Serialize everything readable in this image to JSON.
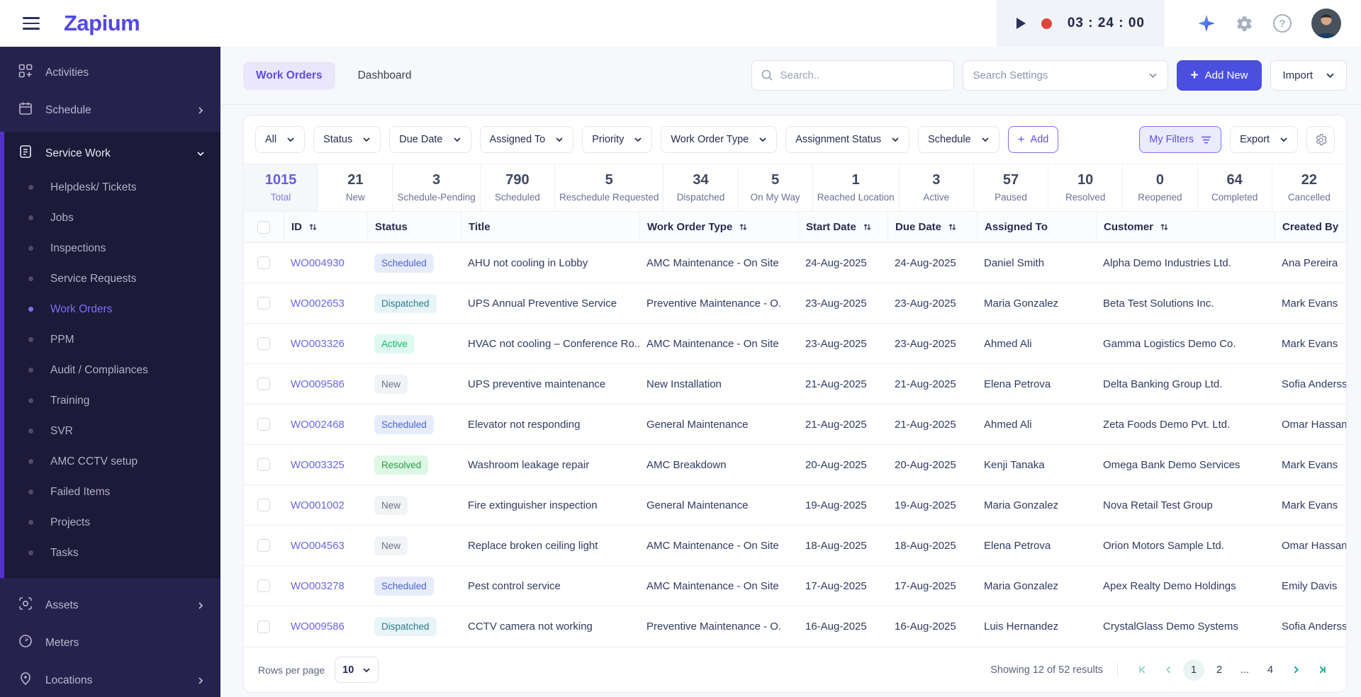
{
  "brand": {
    "name": "Zapium",
    "color": "#5248e5"
  },
  "header": {
    "timer": {
      "time": "03 : 24 : 00"
    }
  },
  "sidebar": {
    "top_items": [
      {
        "label": "Activities"
      },
      {
        "label": "Schedule"
      }
    ],
    "section": {
      "label": "Service Work"
    },
    "sub_items": [
      {
        "label": "Helpdesk/ Tickets",
        "cls": ""
      },
      {
        "label": "Jobs",
        "cls": ""
      },
      {
        "label": "Inspections",
        "cls": ""
      },
      {
        "label": "Service Requests",
        "cls": ""
      },
      {
        "label": "Work Orders",
        "cls": "active"
      },
      {
        "label": "PPM",
        "cls": ""
      },
      {
        "label": "Audit / Compliances",
        "cls": ""
      },
      {
        "label": "Training",
        "cls": ""
      },
      {
        "label": "SVR",
        "cls": ""
      },
      {
        "label": "AMC CCTV setup",
        "cls": ""
      },
      {
        "label": "Failed Items",
        "cls": ""
      },
      {
        "label": "Projects",
        "cls": ""
      },
      {
        "label": "Tasks",
        "cls": ""
      }
    ],
    "bottom_items": [
      {
        "label": "Assets"
      },
      {
        "label": "Meters"
      },
      {
        "label": "Locations"
      }
    ]
  },
  "toolbar": {
    "tabs": [
      {
        "label": "Work Orders"
      },
      {
        "label": "Dashboard"
      }
    ],
    "search_placeholder": "Search..",
    "search_settings_value": "Search Settings",
    "add_new_label": "Add New",
    "import_label": "Import"
  },
  "filters": {
    "dropdowns": [
      {
        "label": "All"
      },
      {
        "label": "Status"
      },
      {
        "label": "Due Date"
      },
      {
        "label": "Assigned To"
      },
      {
        "label": "Priority"
      },
      {
        "label": "Work Order Type"
      },
      {
        "label": "Assignment Status"
      },
      {
        "label": "Schedule"
      }
    ],
    "add_label": "Add",
    "my_filters_label": "My Filters",
    "export_label": "Export"
  },
  "stats": [
    {
      "value": "1015",
      "label": "Total",
      "cls": "total"
    },
    {
      "value": "21",
      "label": "New",
      "cls": ""
    },
    {
      "value": "3",
      "label": "Schedule-Pending",
      "cls": ""
    },
    {
      "value": "790",
      "label": "Scheduled",
      "cls": ""
    },
    {
      "value": "5",
      "label": "Reschedule Requested",
      "cls": ""
    },
    {
      "value": "34",
      "label": "Dispatched",
      "cls": ""
    },
    {
      "value": "5",
      "label": "On My Way",
      "cls": ""
    },
    {
      "value": "1",
      "label": "Reached Location",
      "cls": ""
    },
    {
      "value": "3",
      "label": "Active",
      "cls": ""
    },
    {
      "value": "57",
      "label": "Paused",
      "cls": ""
    },
    {
      "value": "10",
      "label": "Resolved",
      "cls": ""
    },
    {
      "value": "0",
      "label": "Reopened",
      "cls": ""
    },
    {
      "value": "64",
      "label": "Completed",
      "cls": ""
    },
    {
      "value": "22",
      "label": "Cancelled",
      "cls": ""
    }
  ],
  "table": {
    "columns": [
      {
        "label": "ID",
        "sort": "sortable"
      },
      {
        "label": "Status",
        "sort": ""
      },
      {
        "label": "Title",
        "sort": ""
      },
      {
        "label": "Work Order Type",
        "sort": "sortable"
      },
      {
        "label": "Start Date",
        "sort": "sortable"
      },
      {
        "label": "Due Date",
        "sort": "sortable"
      },
      {
        "label": "Assigned To",
        "sort": ""
      },
      {
        "label": "Customer",
        "sort": "sortable"
      },
      {
        "label": "Created By",
        "sort": ""
      }
    ],
    "rows": [
      {
        "id": "WO004930",
        "status": "Scheduled",
        "status_cls": "scheduled",
        "title": "AHU not cooling in Lobby",
        "type": "AMC Maintenance - On Site",
        "start_date": "24-Aug-2025",
        "due_date": "24-Aug-2025",
        "assigned_to": "Daniel Smith",
        "customer": "Alpha Demo Industries Ltd.",
        "created_by": "Ana Pereira"
      },
      {
        "id": "WO002653",
        "status": "Dispatched",
        "status_cls": "dispatched",
        "title": "UPS Annual Preventive Service",
        "type": "Preventive Maintenance - O.",
        "start_date": "23-Aug-2025",
        "due_date": "23-Aug-2025",
        "assigned_to": "Maria Gonzalez",
        "customer": "Beta Test Solutions Inc.",
        "created_by": "Mark Evans"
      },
      {
        "id": "WO003326",
        "status": "Active",
        "status_cls": "active",
        "title": "HVAC not cooling – Conference Ro..",
        "type": "AMC Maintenance - On Site",
        "start_date": "23-Aug-2025",
        "due_date": "23-Aug-2025",
        "assigned_to": "Ahmed Ali",
        "customer": "Gamma Logistics Demo Co.",
        "created_by": "Mark Evans"
      },
      {
        "id": "WO009586",
        "status": "New",
        "status_cls": "new",
        "title": "UPS preventive maintenance",
        "type": "New Installation",
        "start_date": "21-Aug-2025",
        "due_date": "21-Aug-2025",
        "assigned_to": "Elena Petrova",
        "customer": "Delta Banking Group Ltd.",
        "created_by": "Sofia Anderss"
      },
      {
        "id": "WO002468",
        "status": "Scheduled",
        "status_cls": "scheduled",
        "title": "Elevator not responding",
        "type": "General Maintenance",
        "start_date": "21-Aug-2025",
        "due_date": "21-Aug-2025",
        "assigned_to": "Ahmed Ali",
        "customer": "Zeta Foods Demo Pvt. Ltd.",
        "created_by": "Omar Hassan"
      },
      {
        "id": "WO003325",
        "status": "Resolved",
        "status_cls": "resolved",
        "title": "Washroom leakage repair",
        "type": "AMC Breakdown",
        "start_date": "20-Aug-2025",
        "due_date": "20-Aug-2025",
        "assigned_to": "Kenji Tanaka",
        "customer": "Omega Bank Demo Services",
        "created_by": "Mark Evans"
      },
      {
        "id": "WO001002",
        "status": "New",
        "status_cls": "new",
        "title": "Fire extinguisher inspection",
        "type": "General Maintenance",
        "start_date": "19-Aug-2025",
        "due_date": "19-Aug-2025",
        "assigned_to": "Maria Gonzalez",
        "customer": "Nova Retail Test Group",
        "created_by": "Mark Evans"
      },
      {
        "id": "WO004563",
        "status": "New",
        "status_cls": "new",
        "title": "Replace broken ceiling light",
        "type": "AMC Maintenance - On Site",
        "start_date": "18-Aug-2025",
        "due_date": "18-Aug-2025",
        "assigned_to": "Elena Petrova",
        "customer": "Orion Motors Sample Ltd.",
        "created_by": "Omar Hassan"
      },
      {
        "id": "WO003278",
        "status": "Scheduled",
        "status_cls": "scheduled",
        "title": "Pest control service",
        "type": "AMC Maintenance - On Site",
        "start_date": "17-Aug-2025",
        "due_date": "17-Aug-2025",
        "assigned_to": "Maria Gonzalez",
        "customer": "Apex Realty Demo Holdings",
        "created_by": "Emily Davis"
      },
      {
        "id": "WO009586",
        "status": "Dispatched",
        "status_cls": "dispatched",
        "title": "CCTV camera not working",
        "type": "Preventive Maintenance - O.",
        "start_date": "16-Aug-2025",
        "due_date": "16-Aug-2025",
        "assigned_to": "Luis Hernandez",
        "customer": "CrystalGlass Demo Systems",
        "created_by": "Sofia Anderss"
      }
    ]
  },
  "footer": {
    "rows_per_page_label": "Rows per page",
    "rows_per_page_value": "10",
    "showing": "Showing 12 of 52 results",
    "pages": [
      {
        "label": "1",
        "cls": "current"
      },
      {
        "label": "2",
        "cls": ""
      },
      {
        "label": "...",
        "cls": "dots"
      },
      {
        "label": "4",
        "cls": ""
      }
    ]
  },
  "colors": {
    "brand": "#5248e5",
    "sidebar_bg": "#27224d",
    "active_link": "#7b70f5",
    "primary_button": "#4a4fe0",
    "record_red": "#df453c",
    "pagination_teal": "#18a391"
  }
}
